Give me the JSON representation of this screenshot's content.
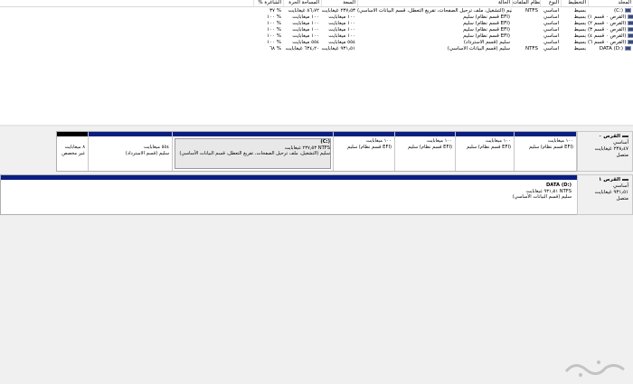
{
  "columns": [
    "المجلد",
    "التخطيط",
    "النوع",
    "نظام الملفات",
    "الحالة",
    "السعة",
    "المساحة الحرة",
    "% الشاغرة"
  ],
  "volumes": [
    {
      "name": "(C:)",
      "layout": "بسيط",
      "type": "أساسي",
      "fs": "NTFS",
      "status": "سليم (التشغيل، ملف ترحيل الصفحات، تفريغ التعطل، قسم البيانات الأساسي)",
      "capacity": "٢٣٧٫٥٣ غيغابايت",
      "free": "٨٦٫٧٢ غيغابايت",
      "pct": "٣٧ %"
    },
    {
      "name": "(القرص ٠ قسم ١)",
      "layout": "بسيط",
      "type": "أساسي",
      "fs": "",
      "status": "سليم (قسم نظام EFI)",
      "capacity": "١٠٠ ميغابايت",
      "free": "١٠٠ ميغابايت",
      "pct": "١٠٠ %"
    },
    {
      "name": "(القرص ٠ قسم ٢)",
      "layout": "بسيط",
      "type": "أساسي",
      "fs": "",
      "status": "سليم (قسم نظام EFI)",
      "capacity": "١٠٠ ميغابايت",
      "free": "١٠٠ ميغابايت",
      "pct": "١٠٠ %"
    },
    {
      "name": "(القرص ٠ قسم ٣)",
      "layout": "بسيط",
      "type": "أساسي",
      "fs": "",
      "status": "سليم (قسم نظام EFI)",
      "capacity": "١٠٠ ميغابايت",
      "free": "١٠٠ ميغابايت",
      "pct": "١٠٠ %"
    },
    {
      "name": "(القرص ٠ قسم ٤)",
      "layout": "بسيط",
      "type": "أساسي",
      "fs": "",
      "status": "سليم (قسم نظام EFI)",
      "capacity": "١٠٠ ميغابايت",
      "free": "١٠٠ ميغابايت",
      "pct": "١٠٠ %"
    },
    {
      "name": "(القرص ٠ قسم ٦)",
      "layout": "بسيط",
      "type": "أساسي",
      "fs": "",
      "status": "سليم (قسم الاسترداد)",
      "capacity": "٥٥٤ ميغابايت",
      "free": "٥٥٤ ميغابايت",
      "pct": "١٠٠ %"
    },
    {
      "name": "DATA (D:)",
      "layout": "بسيط",
      "type": "أساسي",
      "fs": "NTFS",
      "status": "سليم (قسم البيانات الأساسي)",
      "capacity": "٩٣١٫٥١ غيغابايت",
      "free": "٦٣٤٫٢٠ غيغابايت",
      "pct": "٦٨ %"
    }
  ],
  "disk0": {
    "title": "القرص ٠",
    "type": "أساسي",
    "size": "٢٣٨٫٤٧ غيغابايت",
    "status": "متصل",
    "partitions": [
      {
        "line1": "١٠٠ ميغابايت",
        "line2": "سليم (قسم نظام EFI)"
      },
      {
        "line1": "١٠٠ ميغابايت",
        "line2": "سليم (قسم نظام EFI)"
      },
      {
        "line1": "١٠٠ ميغابايت",
        "line2": "سليم (قسم نظام EFI)"
      },
      {
        "line1": "١٠٠ ميغابايت",
        "line2": "سليم (قسم نظام EFI)"
      },
      {
        "line0": "(C:)",
        "line1": "٢٣٧٫٥٣ غيغابايت NTFS",
        "line2": "سليم (التشغيل، ملف ترحيل الصفحات، تفريغ التعطل، قسم البيانات الأساسي)"
      },
      {
        "line1": "٥٥٤ ميغابايت",
        "line2": "سليم (قسم الاسترداد)"
      },
      {
        "line1": "٨ ميغابايت",
        "line2": "غير مخصص"
      }
    ]
  },
  "disk1": {
    "title": "القرص ١",
    "type": "أساسي",
    "size": "٩٣١٫٥١ غيغابايت",
    "status": "متصل",
    "partition": {
      "line0": "DATA (D:)",
      "line1": "٩٣١٫٥١ غيغابايت NTFS",
      "line2": "سليم (قسم البيانات الأساسي)"
    }
  },
  "colors": {
    "primary_bar": "#0a1e82",
    "unallocated_bar": "#000000"
  }
}
